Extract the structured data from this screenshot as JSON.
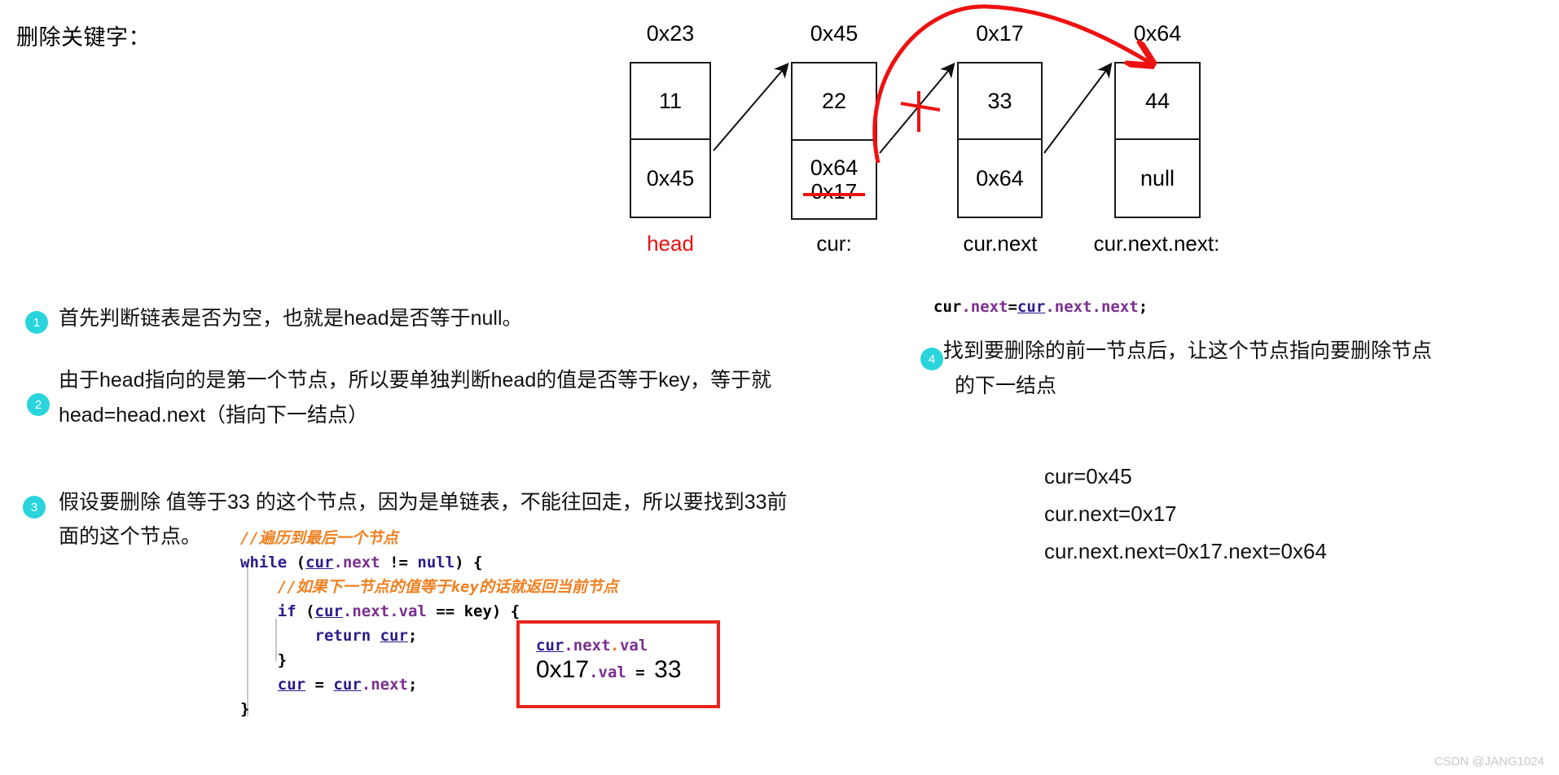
{
  "page": {
    "title": "删除关键字：",
    "watermark": "CSDN @JANG1024"
  },
  "diagram": {
    "nodes": [
      {
        "address": "0x23",
        "value": "11",
        "next": "0x45",
        "next_old": "",
        "label": "head",
        "label_color": "#ee1111"
      },
      {
        "address": "0x45",
        "value": "22",
        "next": "0x64",
        "next_old": "0x17",
        "label": "cur:",
        "label_color": "#000000"
      },
      {
        "address": "0x17",
        "value": "33",
        "next": "0x64",
        "next_old": "",
        "label": "cur.next",
        "label_color": "#000000"
      },
      {
        "address": "0x64",
        "value": "44",
        "next": "null",
        "next_old": "",
        "label": "cur.next.next:",
        "label_color": "#000000"
      }
    ],
    "colors": {
      "redirect_arrow": "#ee1111",
      "cancel_mark": "#ee1111",
      "link_arrow": "#111111"
    }
  },
  "steps": [
    {
      "number": "1",
      "lines": [
        "首先判断链表是否为空，也就是head是否等于null。"
      ]
    },
    {
      "number": "2",
      "lines": [
        "由于head指向的是第一个节点，所以要单独判断head的值是否等于key，等于就",
        "head=head.next（指向下一结点）"
      ]
    },
    {
      "number": "3",
      "lines": [
        "假设要删除 值等于33 的这个节点，因为是单链表，不能往回走，所以要找到33前",
        "面的这个节点。"
      ]
    },
    {
      "number": "4",
      "lines": [
        "找到要删除的前一节点后，让这个节点指向要删除节点",
        "的下一结点"
      ]
    }
  ],
  "code_block": {
    "lines": [
      {
        "indent": 0,
        "tokens": [
          {
            "t": "//遍历到最后一个节点",
            "c": "cmt"
          }
        ]
      },
      {
        "indent": 0,
        "tokens": [
          {
            "t": "while",
            "c": "kw"
          },
          {
            "t": " (",
            "c": "pl"
          },
          {
            "t": "cur",
            "c": "var-u"
          },
          {
            "t": ".next",
            "c": "prop"
          },
          {
            "t": " != ",
            "c": "pl"
          },
          {
            "t": "null",
            "c": "kw"
          },
          {
            "t": ") {",
            "c": "pl"
          }
        ]
      },
      {
        "indent": 1,
        "tokens": [
          {
            "t": "//如果下一节点的值等于key的话就返回当前节点",
            "c": "cmt"
          }
        ]
      },
      {
        "indent": 1,
        "tokens": [
          {
            "t": "if",
            "c": "kw"
          },
          {
            "t": " (",
            "c": "pl"
          },
          {
            "t": "cur",
            "c": "var-u"
          },
          {
            "t": ".next.val",
            "c": "prop"
          },
          {
            "t": " == key) {",
            "c": "pl"
          }
        ]
      },
      {
        "indent": 2,
        "tokens": [
          {
            "t": "return ",
            "c": "kw"
          },
          {
            "t": "cur",
            "c": "var-u"
          },
          {
            "t": ";",
            "c": "pl"
          }
        ]
      },
      {
        "indent": 1,
        "tokens": [
          {
            "t": "}",
            "c": "pl"
          }
        ]
      },
      {
        "indent": 1,
        "tokens": [
          {
            "t": "cur",
            "c": "var-u"
          },
          {
            "t": " = ",
            "c": "pl"
          },
          {
            "t": "cur",
            "c": "var-u"
          },
          {
            "t": ".next",
            "c": "prop"
          },
          {
            "t": ";",
            "c": "pl"
          }
        ]
      },
      {
        "indent": 0,
        "tokens": [
          {
            "t": "}",
            "c": "pl"
          }
        ]
      }
    ]
  },
  "value_box": {
    "line1": [
      {
        "t": "cur",
        "c": "var-u"
      },
      {
        "t": ".next",
        "c": "prop"
      },
      {
        "t": ".",
        "c": "cmt"
      },
      {
        "t": "val",
        "c": "prop"
      }
    ],
    "line2_big": "0x17",
    "line2_small": ".val",
    "line2_eq": " = ",
    "line2_result": "33",
    "border_color": "#e8241e"
  },
  "right_code": {
    "tokens": [
      {
        "t": "cur",
        "c": "pl"
      },
      {
        "t": ".next",
        "c": "prop"
      },
      {
        "t": "=",
        "c": "pl"
      },
      {
        "t": "cur",
        "c": "var-u"
      },
      {
        "t": ".next.next",
        "c": "prop"
      },
      {
        "t": ";",
        "c": "pl"
      }
    ]
  },
  "right_values": [
    "cur=0x45",
    "cur.next=0x17",
    "cur.next.next=0x17.next=0x64"
  ]
}
